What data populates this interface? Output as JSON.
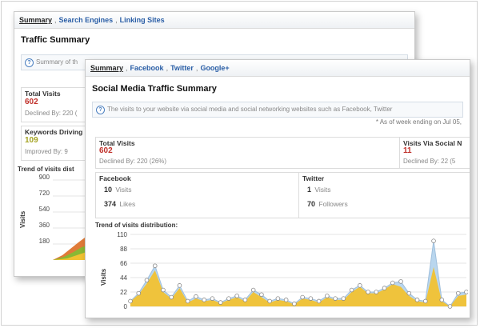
{
  "back_panel": {
    "tabs": [
      "Summary",
      "Search Engines",
      "Linking Sites"
    ],
    "title": "Traffic Summary",
    "info": "Summary of th",
    "total_visits": {
      "label": "Total Visits",
      "value": "602",
      "sub": "Declined By: 220 ("
    },
    "keywords": {
      "label": "Keywords Driving",
      "value": "109",
      "sub": "Improved By: 9"
    },
    "trend_label": "Trend of visits dist",
    "yticks": [
      "900",
      "720",
      "540",
      "360",
      "180"
    ],
    "ylabel": "Visits"
  },
  "front_panel": {
    "tabs": [
      "Summary",
      "Facebook",
      "Twitter",
      "Google+"
    ],
    "title": "Social Media Traffic Summary",
    "info": "The visits to your website via social media and social networking websites such as Facebook, Twitter",
    "note": "* As of week ending on Jul 05,",
    "total_visits": {
      "label": "Total Visits",
      "value": "602",
      "sub": "Declined By: 220 (26%)"
    },
    "visits_social": {
      "label": "Visits Via Social N",
      "value": "11",
      "sub": "Declined By: 22 (5"
    },
    "facebook": {
      "label": "Facebook",
      "visits_num": "10",
      "visits_label": "Visits",
      "likes_num": "374",
      "likes_label": "Likes"
    },
    "twitter": {
      "label": "Twitter",
      "visits_num": "1",
      "visits_label": "Visits",
      "followers_num": "70",
      "followers_label": "Followers"
    },
    "trend_label": "Trend of visits distribution:",
    "ylabel": "Visits"
  },
  "chart_data": {
    "type": "area",
    "title": "Trend of visits distribution:",
    "ylabel": "Visits",
    "y_ticks": [
      "110",
      "88",
      "66",
      "44",
      "22",
      "0"
    ],
    "ylim": [
      0,
      110
    ],
    "series": [
      {
        "color": "#b9d6ee",
        "values": [
          8,
          20,
          40,
          62,
          25,
          14,
          32,
          8,
          15,
          10,
          12,
          6,
          12,
          16,
          10,
          25,
          18,
          8,
          12,
          10,
          4,
          14,
          12,
          8,
          16,
          12,
          12,
          25,
          32,
          22,
          22,
          28,
          36,
          38,
          20,
          10,
          8,
          100,
          10,
          0,
          20,
          22
        ]
      },
      {
        "color": "#f1c232",
        "values": [
          8,
          18,
          35,
          55,
          22,
          12,
          28,
          6,
          12,
          8,
          10,
          5,
          10,
          14,
          8,
          22,
          14,
          6,
          10,
          8,
          3,
          12,
          10,
          6,
          14,
          10,
          10,
          22,
          30,
          20,
          20,
          26,
          34,
          30,
          16,
          8,
          6,
          60,
          8,
          0,
          16,
          18
        ]
      }
    ],
    "colors": {
      "back_areas": [
        "#e07b39",
        "#8ab834",
        "#f1c232"
      ]
    }
  }
}
